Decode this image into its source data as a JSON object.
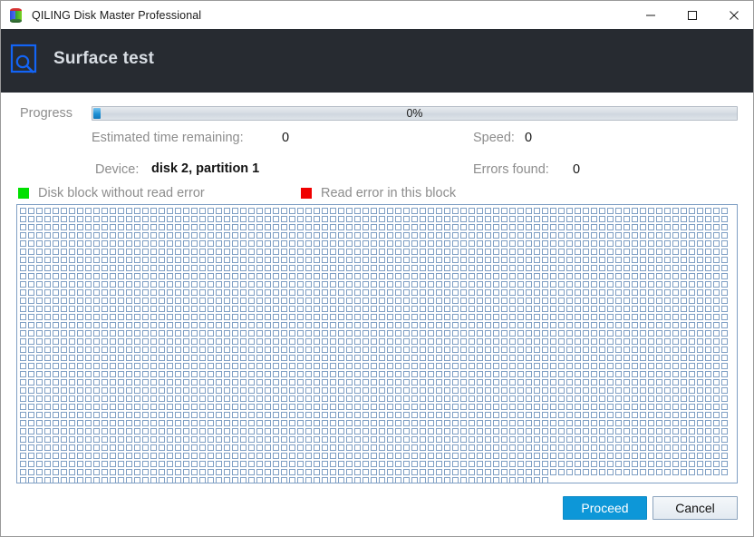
{
  "window": {
    "title": "QILING Disk Master Professional",
    "app_icon": "cube-icon",
    "controls": {
      "minimize": "minimize-icon",
      "maximize": "maximize-icon",
      "close": "close-icon"
    }
  },
  "header": {
    "icon": "surface-scan-icon",
    "title": "Surface test",
    "background_color": "#272b31"
  },
  "progress": {
    "label": "Progress",
    "percent_text": "0%",
    "percent_value": 0,
    "fill_color": "#1b8fd4"
  },
  "info": {
    "estimated_time_label": "Estimated time remaining:",
    "estimated_time_value": "0",
    "speed_label": "Speed:",
    "speed_value": "0",
    "device_label": "Device:",
    "device_value": "disk 2, partition 1",
    "errors_label": "Errors found:",
    "errors_value": "0"
  },
  "legend": {
    "ok_label": "Disk block without read error",
    "ok_color": "#00e000",
    "error_label": "Read error in this block",
    "error_color": "#f00000"
  },
  "blockmap": {
    "columns": 87,
    "rows": 34,
    "last_row_count": 65,
    "total_blocks": 3023,
    "scanned_ok": 0,
    "scanned_error": 0,
    "cell_border_color": "#7f9fc4"
  },
  "buttons": {
    "proceed": "Proceed",
    "cancel": "Cancel",
    "proceed_color": "#0d97d8"
  }
}
